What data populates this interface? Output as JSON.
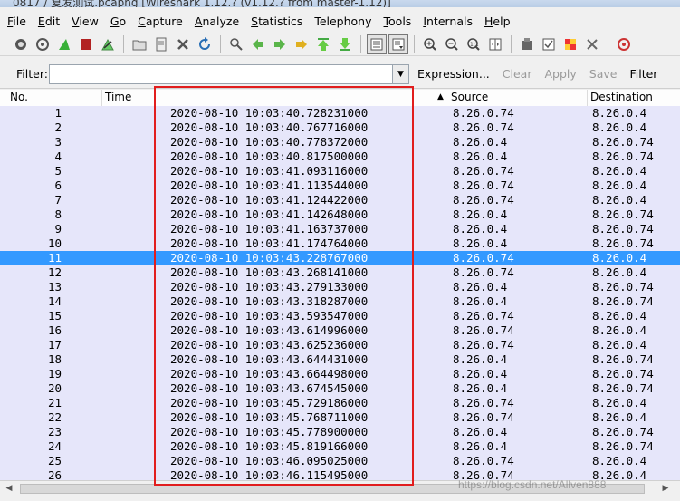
{
  "window": {
    "title": "0817 / 复发测试.pcapng  [Wireshark 1.12.? (v1.12.? from master-1.12)]"
  },
  "menu": [
    {
      "label": "File",
      "key": "F",
      "rest": "ile"
    },
    {
      "label": "Edit",
      "key": "E",
      "rest": "dit"
    },
    {
      "label": "View",
      "key": "V",
      "rest": "iew"
    },
    {
      "label": "Go",
      "key": "G",
      "rest": "o"
    },
    {
      "label": "Capture",
      "key": "C",
      "rest": "apture"
    },
    {
      "label": "Analyze",
      "key": "A",
      "rest": "nalyze"
    },
    {
      "label": "Statistics",
      "key": "S",
      "rest": "tatistics"
    },
    {
      "label": "Telephony",
      "key": "",
      "rest": "Telephony"
    },
    {
      "label": "Tools",
      "key": "T",
      "rest": "ools"
    },
    {
      "label": "Internals",
      "key": "I",
      "rest": "nternals"
    },
    {
      "label": "Help",
      "key": "H",
      "rest": "elp"
    }
  ],
  "toolbar_icons": [
    "interface-list-icon",
    "capture-options-icon",
    "start-capture-icon",
    "stop-capture-icon",
    "restart-capture-icon",
    "open-file-icon",
    "save-file-icon",
    "close-file-icon",
    "reload-icon",
    "find-packet-icon",
    "go-back-icon",
    "go-forward-icon",
    "go-to-packet-icon",
    "go-first-icon",
    "go-last-icon",
    "colorize-icon",
    "auto-scroll-icon",
    "zoom-in-icon",
    "zoom-out-icon",
    "zoom-normal-icon",
    "resize-columns-icon",
    "capture-filters-icon",
    "display-filters-icon",
    "coloring-rules-icon",
    "preferences-icon",
    "help-icon"
  ],
  "filter": {
    "label": "Filter:",
    "value": "",
    "expression": "Expression...",
    "clear": "Clear",
    "apply": "Apply",
    "save": "Save",
    "filter_btn": "Filter"
  },
  "columns": {
    "no": "No.",
    "time": "Time",
    "source": "Source",
    "destination": "Destination"
  },
  "selected_row": 11,
  "packets": [
    {
      "no": "1",
      "time": "2020-08-10 10:03:40.728231000",
      "src": "8.26.0.74",
      "dst": "8.26.0.4"
    },
    {
      "no": "2",
      "time": "2020-08-10 10:03:40.767716000",
      "src": "8.26.0.74",
      "dst": "8.26.0.4"
    },
    {
      "no": "3",
      "time": "2020-08-10 10:03:40.778372000",
      "src": "8.26.0.4",
      "dst": "8.26.0.74"
    },
    {
      "no": "4",
      "time": "2020-08-10 10:03:40.817500000",
      "src": "8.26.0.4",
      "dst": "8.26.0.74"
    },
    {
      "no": "5",
      "time": "2020-08-10 10:03:41.093116000",
      "src": "8.26.0.74",
      "dst": "8.26.0.4"
    },
    {
      "no": "6",
      "time": "2020-08-10 10:03:41.113544000",
      "src": "8.26.0.74",
      "dst": "8.26.0.4"
    },
    {
      "no": "7",
      "time": "2020-08-10 10:03:41.124422000",
      "src": "8.26.0.74",
      "dst": "8.26.0.4"
    },
    {
      "no": "8",
      "time": "2020-08-10 10:03:41.142648000",
      "src": "8.26.0.4",
      "dst": "8.26.0.74"
    },
    {
      "no": "9",
      "time": "2020-08-10 10:03:41.163737000",
      "src": "8.26.0.4",
      "dst": "8.26.0.74"
    },
    {
      "no": "10",
      "time": "2020-08-10 10:03:41.174764000",
      "src": "8.26.0.4",
      "dst": "8.26.0.74"
    },
    {
      "no": "11",
      "time": "2020-08-10 10:03:43.228767000",
      "src": "8.26.0.74",
      "dst": "8.26.0.4"
    },
    {
      "no": "12",
      "time": "2020-08-10 10:03:43.268141000",
      "src": "8.26.0.74",
      "dst": "8.26.0.4"
    },
    {
      "no": "13",
      "time": "2020-08-10 10:03:43.279133000",
      "src": "8.26.0.4",
      "dst": "8.26.0.74"
    },
    {
      "no": "14",
      "time": "2020-08-10 10:03:43.318287000",
      "src": "8.26.0.4",
      "dst": "8.26.0.74"
    },
    {
      "no": "15",
      "time": "2020-08-10 10:03:43.593547000",
      "src": "8.26.0.74",
      "dst": "8.26.0.4"
    },
    {
      "no": "16",
      "time": "2020-08-10 10:03:43.614996000",
      "src": "8.26.0.74",
      "dst": "8.26.0.4"
    },
    {
      "no": "17",
      "time": "2020-08-10 10:03:43.625236000",
      "src": "8.26.0.74",
      "dst": "8.26.0.4"
    },
    {
      "no": "18",
      "time": "2020-08-10 10:03:43.644431000",
      "src": "8.26.0.4",
      "dst": "8.26.0.74"
    },
    {
      "no": "19",
      "time": "2020-08-10 10:03:43.664498000",
      "src": "8.26.0.4",
      "dst": "8.26.0.74"
    },
    {
      "no": "20",
      "time": "2020-08-10 10:03:43.674545000",
      "src": "8.26.0.4",
      "dst": "8.26.0.74"
    },
    {
      "no": "21",
      "time": "2020-08-10 10:03:45.729186000",
      "src": "8.26.0.74",
      "dst": "8.26.0.4"
    },
    {
      "no": "22",
      "time": "2020-08-10 10:03:45.768711000",
      "src": "8.26.0.74",
      "dst": "8.26.0.4"
    },
    {
      "no": "23",
      "time": "2020-08-10 10:03:45.778900000",
      "src": "8.26.0.4",
      "dst": "8.26.0.74"
    },
    {
      "no": "24",
      "time": "2020-08-10 10:03:45.819166000",
      "src": "8.26.0.4",
      "dst": "8.26.0.74"
    },
    {
      "no": "25",
      "time": "2020-08-10 10:03:46.095025000",
      "src": "8.26.0.74",
      "dst": "8.26.0.4"
    },
    {
      "no": "26",
      "time": "2020-08-10 10:03:46.115495000",
      "src": "8.26.0.74",
      "dst": "8.26.0.4"
    }
  ],
  "watermark": "https://blog.csdn.net/Allven888",
  "colors": {
    "row_bg": "#e6e6fa",
    "selected_bg": "#3399ff",
    "annotation_box": "#e11d1d"
  }
}
